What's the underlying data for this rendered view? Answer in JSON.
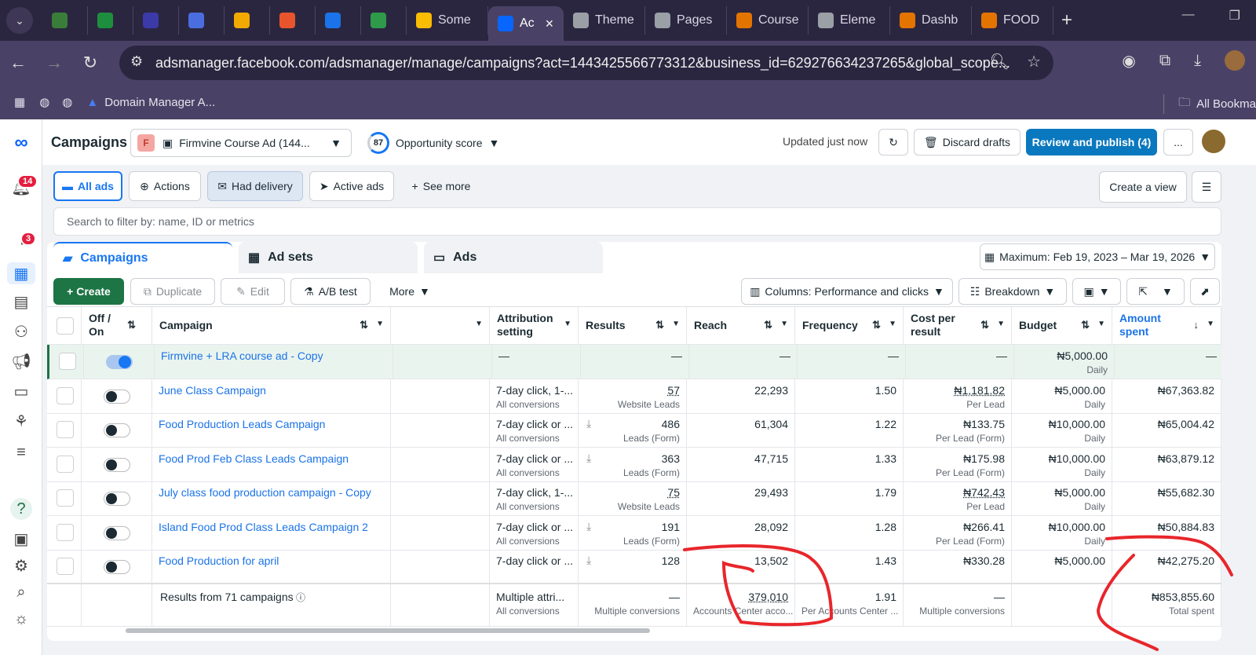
{
  "browser": {
    "tabs": [
      {
        "label": "",
        "color": "#3a7d3a"
      },
      {
        "label": "",
        "color": "#1e8e3e"
      },
      {
        "label": "",
        "color": "#3b3aa8"
      },
      {
        "label": "",
        "color": "#4a6ee0"
      },
      {
        "label": "",
        "color": "#f2a900"
      },
      {
        "label": "",
        "color": "#e8552d"
      },
      {
        "label": "",
        "color": "#1a73e8"
      },
      {
        "label": "",
        "color": "#2e9a4a"
      },
      {
        "label": "Some",
        "color": "#fbbc04"
      },
      {
        "label": "Ac",
        "color": "#0866ff",
        "active": true
      },
      {
        "label": "Theme",
        "color": "#9aa0a6"
      },
      {
        "label": "Pages",
        "color": "#9aa0a6"
      },
      {
        "label": "Course",
        "color": "#e37400"
      },
      {
        "label": "Eleme",
        "color": "#9aa0a6"
      },
      {
        "label": "Dashb",
        "color": "#e37400"
      },
      {
        "label": "FOOD",
        "color": "#e37400"
      }
    ],
    "url": "adsmanager.facebook.com/adsmanager/manage/campaigns?act=1443425566773312&business_id=629276634237265&global_scope...",
    "bookmarks": {
      "domain_manager": "Domain Manager A...",
      "all_bookmarks": "All Bookma"
    }
  },
  "rail": {
    "notif_badge": "14",
    "chat_badge": "3"
  },
  "header": {
    "title": "Campaigns",
    "account_initial": "F",
    "account_name": "Firmvine Course Ad (144...",
    "opp_score": "87",
    "opp_label": "Opportunity score",
    "updated": "Updated just now",
    "discard": "Discard drafts",
    "review": "Review and publish (4)",
    "more": "..."
  },
  "filters": {
    "all_ads": "All ads",
    "actions": "Actions",
    "had_delivery": "Had delivery",
    "active_ads": "Active ads",
    "see_more": "See more",
    "create_view": "Create a view"
  },
  "search": {
    "placeholder": "Search to filter by: name, ID or metrics"
  },
  "level_tabs": {
    "campaigns": "Campaigns",
    "ad_sets": "Ad sets",
    "ads": "Ads"
  },
  "date_range": "Maximum: Feb 19, 2023 – Mar 19, 2026",
  "toolbar": {
    "create": "+ Create",
    "duplicate": "Duplicate",
    "edit": "Edit",
    "ab_test": "A/B test",
    "more": "More",
    "columns": "Columns: Performance and clicks",
    "breakdown": "Breakdown"
  },
  "columns": {
    "off_on": "Off / On",
    "campaign": "Campaign",
    "attribution": "Attribution setting",
    "results": "Results",
    "reach": "Reach",
    "frequency": "Frequency",
    "cost_per_result": "Cost per result",
    "budget": "Budget",
    "amount_spent": "Amount spent"
  },
  "rows": [
    {
      "name": "Firmvine + LRA course ad - Copy",
      "on": true,
      "attr": "—",
      "attr_sub": "",
      "results": "—",
      "results_sub": "",
      "reach": "—",
      "freq": "—",
      "cpr": "—",
      "cpr_sub": "",
      "budget": "₦5,000.00",
      "budget_sub": "Daily",
      "spent": "—"
    },
    {
      "name": "June Class Campaign",
      "on": false,
      "attr": "7-day click, 1-...",
      "attr_sub": "All conversions",
      "results": "57",
      "results_sub": "Website Leads",
      "reach": "22,293",
      "freq": "1.50",
      "cpr": "₦1,181.82",
      "cpr_sub": "Per Lead",
      "budget": "₦5,000.00",
      "budget_sub": "Daily",
      "spent": "₦67,363.82"
    },
    {
      "name": "Food Production Leads Campaign",
      "on": false,
      "attr": "7-day click or ...",
      "attr_sub": "All conversions",
      "results": "486",
      "results_sub": "Leads (Form)",
      "reach": "61,304",
      "freq": "1.22",
      "cpr": "₦133.75",
      "cpr_sub": "Per Lead (Form)",
      "budget": "₦10,000.00",
      "budget_sub": "Daily",
      "spent": "₦65,004.42"
    },
    {
      "name": "Food Prod Feb Class Leads Campaign",
      "on": false,
      "attr": "7-day click or ...",
      "attr_sub": "All conversions",
      "results": "363",
      "results_sub": "Leads (Form)",
      "reach": "47,715",
      "freq": "1.33",
      "cpr": "₦175.98",
      "cpr_sub": "Per Lead (Form)",
      "budget": "₦10,000.00",
      "budget_sub": "Daily",
      "spent": "₦63,879.12"
    },
    {
      "name": "July class food production campaign - Copy",
      "on": false,
      "attr": "7-day click, 1-...",
      "attr_sub": "All conversions",
      "results": "75",
      "results_sub": "Website Leads",
      "reach": "29,493",
      "freq": "1.79",
      "cpr": "₦742.43",
      "cpr_sub": "Per Lead",
      "budget": "₦5,000.00",
      "budget_sub": "Daily",
      "spent": "₦55,682.30"
    },
    {
      "name": "Island Food Prod Class Leads Campaign 2",
      "on": false,
      "attr": "7-day click or ...",
      "attr_sub": "All conversions",
      "results": "191",
      "results_sub": "Leads (Form)",
      "reach": "28,092",
      "freq": "1.28",
      "cpr": "₦266.41",
      "cpr_sub": "Per Lead (Form)",
      "budget": "₦10,000.00",
      "budget_sub": "Daily",
      "spent": "₦50,884.83"
    },
    {
      "name": "Food Production for april",
      "on": false,
      "attr": "7-day click or ...",
      "attr_sub": "",
      "results": "128",
      "results_sub": "",
      "reach": "13,502",
      "freq": "1.43",
      "cpr": "₦330.28",
      "cpr_sub": "",
      "budget": "₦5,000.00",
      "budget_sub": "",
      "spent": "₦42,275.20"
    }
  ],
  "totals": {
    "label": "Results from 71 campaigns",
    "attr": "Multiple attri...",
    "attr_sub": "All conversions",
    "results": "—",
    "results_sub": "Multiple conversions",
    "reach": "379,010",
    "reach_sub": "Accounts Center acco...",
    "freq": "1.91",
    "freq_sub": "Per Accounts Center ...",
    "cpr": "—",
    "cpr_sub": "Multiple conversions",
    "spent": "₦853,855.60",
    "spent_sub": "Total spent"
  },
  "colors": {
    "brand_blue": "#0a78be",
    "green": "#1d7445",
    "annotation_red": "#e8262b"
  }
}
